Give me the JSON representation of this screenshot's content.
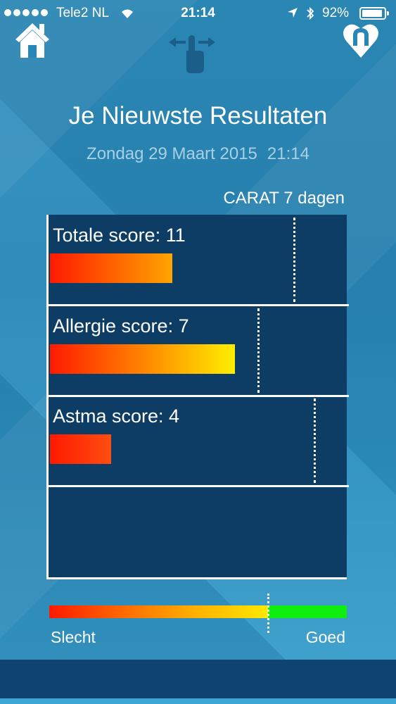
{
  "status_bar": {
    "carrier": "Tele2 NL",
    "time": "21:14",
    "battery": "92%",
    "battery_level": 0.92
  },
  "header": {
    "title": "Je Nieuwste Resultaten",
    "date": "Zondag 29 Maart 2015",
    "time": "21:14"
  },
  "chart_data": {
    "type": "bar",
    "title": "CARAT 7 dagen",
    "series": [
      {
        "label": "Totale score: 11",
        "score": 11,
        "bar_fraction": 0.41,
        "target_fraction": 0.82,
        "gradient": [
          "#ff1a00",
          "#ffa500"
        ]
      },
      {
        "label": "Allergie score: 7",
        "score": 7,
        "bar_fraction": 0.62,
        "target_fraction": 0.7,
        "gradient": [
          "#ff1a00",
          "#ffee00"
        ]
      },
      {
        "label": "Astma score: 4",
        "score": 4,
        "bar_fraction": 0.205,
        "target_fraction": 0.89,
        "gradient": [
          "#ff1a00",
          "#ff4d10"
        ]
      }
    ]
  },
  "scale": {
    "bad_label": "Slecht",
    "good_label": "Goed",
    "threshold_fraction": 0.736,
    "bad_color": "#ff1a00",
    "good_color": "#10ee10"
  },
  "icons": {
    "home": "home-icon",
    "swipe": "swipe-hand-icon",
    "heart": "heart-logo-icon"
  }
}
